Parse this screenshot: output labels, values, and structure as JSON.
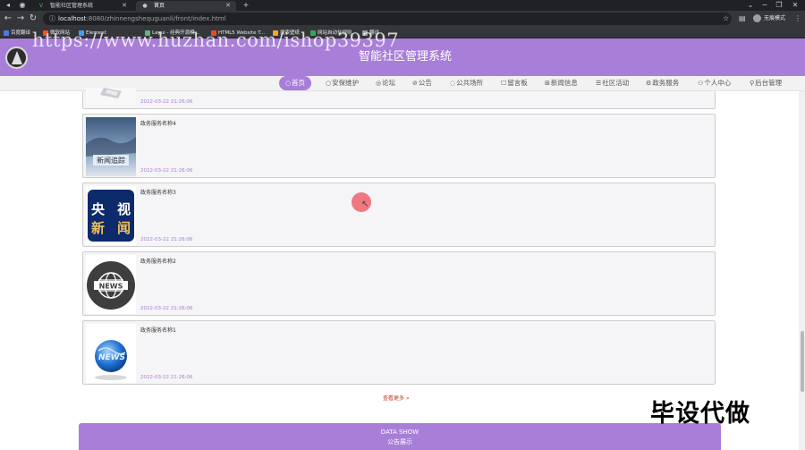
{
  "browser": {
    "tabs": [
      {
        "title": "智能社区管理系统"
      },
      {
        "title": "首页"
      }
    ],
    "new_tab": "+",
    "window_controls": [
      "⌄",
      "─",
      "❐",
      "✕"
    ],
    "url_host": "localhost",
    "url_rest": ":8080/zhinnengshequguanli/front/index.html",
    "profile_label": "无痕模式",
    "bookmarks": [
      {
        "label": "百度翻译",
        "color": "#4a7ce8"
      },
      {
        "label": "微软网站",
        "color": "#f35325"
      },
      {
        "label": "Element",
        "color": "#409eff"
      },
      {
        "label": "Layui - 经典开源模...",
        "color": "#5fb878"
      },
      {
        "label": "HTML5 Website T...",
        "color": "#e44d26"
      },
      {
        "label": "搜索壁纸",
        "color": "#f5a623"
      },
      {
        "label": "网站自动化规则",
        "color": "#34a853"
      },
      {
        "label": "翻译",
        "color": "#9aa0a6"
      }
    ]
  },
  "watermark": "https://www.huzhan.com/ishop39397",
  "header": {
    "title": "智能社区管理系统"
  },
  "nav": [
    {
      "icon": "○",
      "label": "首页"
    },
    {
      "icon": "○",
      "label": "安保维护"
    },
    {
      "icon": "◎",
      "label": "论坛"
    },
    {
      "icon": "⊘",
      "label": "公告"
    },
    {
      "icon": "◌",
      "label": "公共场所"
    },
    {
      "icon": "☐",
      "label": "留言板"
    },
    {
      "icon": "⊞",
      "label": "新闻信息"
    },
    {
      "icon": "☰",
      "label": "社区活动"
    },
    {
      "icon": "⚙",
      "label": "政务服务"
    },
    {
      "icon": "⚇",
      "label": "个人中心"
    },
    {
      "icon": "⚲",
      "label": "后台管理"
    }
  ],
  "services": [
    {
      "name": "",
      "date": "2022-03-22 21:26:06"
    },
    {
      "name": "政务服务名称4",
      "date": "2022-03-22 21:26:06",
      "thumb_text": "新闻追踪"
    },
    {
      "name": "政务服务名称3",
      "date": "2022-03-22 21:26:06",
      "thumb_text": "央视新闻"
    },
    {
      "name": "政务服务名称2",
      "date": "2022-03-22 21:26:06",
      "thumb_text": "NEWS"
    },
    {
      "name": "政务服务名称1",
      "date": "2022-03-22 21:26:06",
      "thumb_text": "NEWS"
    }
  ],
  "more_label": "查看更多 »",
  "footer": {
    "en": "DATA SHOW",
    "zh": "公告展示"
  },
  "overlay_text": "毕设代做",
  "colors": {
    "accent": "#a87ed8",
    "browser_dark": "#202124",
    "browser_mid": "#35363a"
  }
}
